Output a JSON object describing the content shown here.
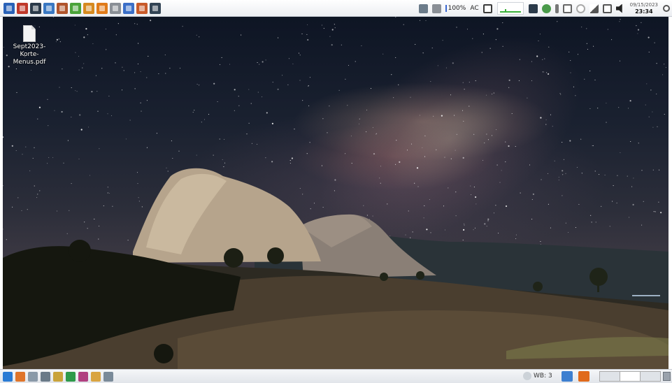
{
  "top_panel": {
    "launchers": [
      {
        "icon": "close-x-icon",
        "color": "#2a62b8"
      },
      {
        "icon": "stop-icon",
        "color": "#c0392b"
      },
      {
        "icon": "terminal-icon",
        "color": "#2b3a4a"
      },
      {
        "icon": "search-icon",
        "color": "#3a78c2"
      },
      {
        "icon": "settings-icon",
        "color": "#b0542c"
      },
      {
        "icon": "edit-icon",
        "color": "#4ba33a"
      },
      {
        "icon": "package-icon",
        "color": "#d68a20"
      },
      {
        "icon": "person-icon",
        "color": "#e07b1a"
      },
      {
        "icon": "calculator-icon",
        "color": "#8a8f96"
      },
      {
        "icon": "editor-icon",
        "color": "#3b6fc8"
      },
      {
        "icon": "image-viewer-icon",
        "color": "#c85a2a"
      },
      {
        "icon": "screen-icon",
        "color": "#334455"
      }
    ],
    "tray": {
      "battery_percent": "100%",
      "power_source": "AC",
      "clock_date": "09/15/2023",
      "clock_time": "23:34",
      "icons": [
        {
          "icon": "disk-icon",
          "color": "#6b7b8a"
        },
        {
          "icon": "clipboard-icon",
          "color": "#8a8f96"
        },
        {
          "icon": "battery-icon",
          "color": "#3a3a3a"
        },
        {
          "icon": "network-icon",
          "color": "#2b3a4a"
        },
        {
          "icon": "update-icon",
          "color": "#4a9a4a"
        },
        {
          "icon": "bluetooth-icon",
          "color": "#666666"
        },
        {
          "icon": "usb-icon",
          "color": "#666666"
        },
        {
          "icon": "shield-icon",
          "color": "#999999"
        },
        {
          "icon": "wifi-icon",
          "color": "#555555"
        },
        {
          "icon": "notes-icon",
          "color": "#555555"
        },
        {
          "icon": "volume-icon",
          "color": "#222222"
        }
      ]
    }
  },
  "desktop": {
    "file_name": "Sept2023-Korte-Menus.pdf"
  },
  "bottom_panel": {
    "launchers": [
      {
        "icon": "menu-icon",
        "color": "#2a7bd4"
      },
      {
        "icon": "browser-icon",
        "color": "#e0752a"
      },
      {
        "icon": "files-icon",
        "color": "#8a9aa8"
      },
      {
        "icon": "tools-icon",
        "color": "#6a7a88"
      },
      {
        "icon": "pen-icon",
        "color": "#c9a33a"
      },
      {
        "icon": "check-icon",
        "color": "#2e9a4a"
      },
      {
        "icon": "user-icon",
        "color": "#b04080"
      },
      {
        "icon": "folder-icon",
        "color": "#d9a441"
      },
      {
        "icon": "window-icon",
        "color": "#7a8a99"
      }
    ],
    "workspace_label": "WB: 3",
    "tasks": [
      {
        "icon": "monitor-task-icon",
        "color": "#3d7fd0"
      },
      {
        "icon": "firefox-task-icon",
        "color": "#e06a1c"
      }
    ],
    "workspaces": 3
  }
}
